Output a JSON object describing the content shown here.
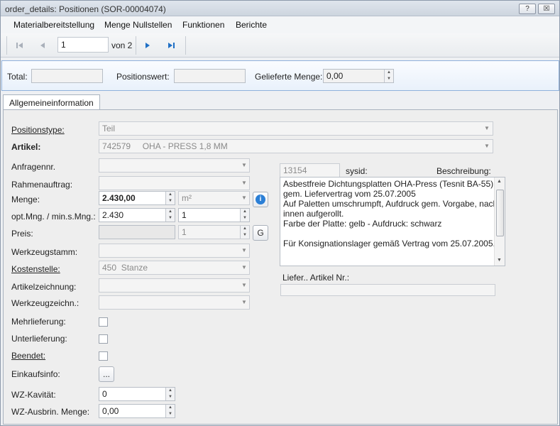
{
  "window": {
    "title": "order_details: Positionen (SOR-00004074)",
    "help_label": "?",
    "close_label": "☒"
  },
  "menu": {
    "items": [
      "Materialbereitstellung",
      "Menge Nullstellen",
      "Funktionen",
      "Berichte"
    ]
  },
  "navigator": {
    "current_page": "1",
    "of_label": "von 2"
  },
  "totals": {
    "total_label": "Total:",
    "total_value": "",
    "positionswert_label": "Positionswert:",
    "positionswert_value": "",
    "gelieferte_label": "Gelieferte Menge:",
    "gelieferte_value": "0,00"
  },
  "tabs": {
    "active": "Allgemeineinformation"
  },
  "form": {
    "positionstype": {
      "label": "Positionstype:",
      "value": "Teil"
    },
    "artikel": {
      "label": "Artikel:",
      "value": "742579     OHA - PRESS 1,8 MM"
    },
    "anfragennr": {
      "label": "Anfragennr.",
      "value": ""
    },
    "rahmenauftrag": {
      "label": "Rahmenauftrag:",
      "value": ""
    },
    "menge": {
      "label": "Menge:",
      "value": "2.430,00",
      "unit": "m²"
    },
    "optmng": {
      "label": "opt.Mng. / min.s.Mng.:",
      "value": "2.430",
      "min_value": "1"
    },
    "preis": {
      "label": "Preis:",
      "value": "",
      "qty": "1",
      "g_button": "G"
    },
    "werkzeugstamm": {
      "label": "Werkzeugstamm:",
      "value": ""
    },
    "kostenstelle": {
      "label": "Kostenstelle:",
      "value": "450  Stanze"
    },
    "artikelzeichnung": {
      "label": "Artikelzeichnung:",
      "value": ""
    },
    "werkzeugzeichn": {
      "label": "Werkzeugzeichn.:",
      "value": ""
    },
    "mehrlieferung": {
      "label": "Mehrlieferung:"
    },
    "unterlieferung": {
      "label": "Unterlieferung:"
    },
    "beendet": {
      "label": "Beendet:"
    },
    "einkaufsinfo": {
      "label": "Einkaufsinfo:",
      "button": "..."
    },
    "wzkavitaet": {
      "label": "WZ-Kavität:",
      "value": "0"
    },
    "wzausbrin": {
      "label": "WZ-Ausbrin. Menge:",
      "value": "0,00"
    }
  },
  "right": {
    "sysid_value": "13154",
    "sysid_label": "sysid:",
    "beschreibung_label": "Beschreibung:",
    "beschreibung_lines": [
      "Asbestfreie Dichtungsplatten OHA-Press (Tesnit BA-55)",
      "gem. Liefervertrag vom 25.07.2005",
      "Auf Paletten umschrumpft, Aufdruck gem. Vorgabe, nach",
      "innen aufgerollt.",
      "Farbe der Platte: gelb - Aufdruck: schwarz",
      "",
      "Für Konsignationslager gemäß Vertrag vom 25.07.2005."
    ],
    "lieferartikel_label": "Liefer.. Artikel Nr.:",
    "lieferartikel_value": ""
  },
  "colors": {
    "accent_border": "#8fb1dc",
    "info_blue": "#2b7fd6"
  }
}
